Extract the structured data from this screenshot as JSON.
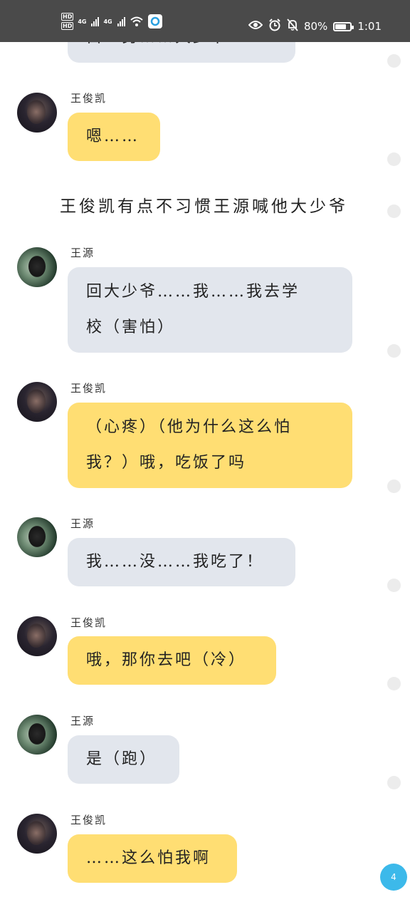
{
  "status_bar": {
    "hd1": "HD",
    "hd2": "HD",
    "net1": "4G",
    "net2": "4G",
    "battery_text": "80%",
    "battery_level": 0.8,
    "time": "1:01",
    "icons": [
      "eye-icon",
      "alarm-icon",
      "mute-bell-icon",
      "battery-icon",
      "wifi-icon",
      "signal-icon"
    ]
  },
  "messages": [
    {
      "sender": "",
      "text": "白：努……大少爷",
      "style": "grey",
      "partial": true
    },
    {
      "sender": "王俊凯",
      "text": "嗯……",
      "style": "yellow"
    },
    {
      "narration": "王俊凯有点不习惯王源喊他大少爷"
    },
    {
      "sender": "王源",
      "text_lines": [
        "回大少爷……我……我去学",
        "校（害怕）"
      ],
      "style": "grey"
    },
    {
      "sender": "王俊凯",
      "text_lines": [
        "（心疼）（他为什么这么怕",
        "我？）哦，吃饭了吗"
      ],
      "style": "yellow"
    },
    {
      "sender": "王源",
      "text": "我……没……我吃了！",
      "style": "grey"
    },
    {
      "sender": "王俊凯",
      "text": "哦，那你去吧（冷）",
      "style": "yellow"
    },
    {
      "sender": "王源",
      "text": "是（跑）",
      "style": "grey"
    },
    {
      "sender": "王俊凯",
      "text": "……这么怕我啊",
      "style": "yellow"
    }
  ],
  "fab": {
    "label": "4"
  },
  "colors": {
    "yellow_bubble": "#ffde73",
    "grey_bubble": "#e2e6ed",
    "fab": "#3cb9ea",
    "status_bar": "#4a4a4a"
  }
}
